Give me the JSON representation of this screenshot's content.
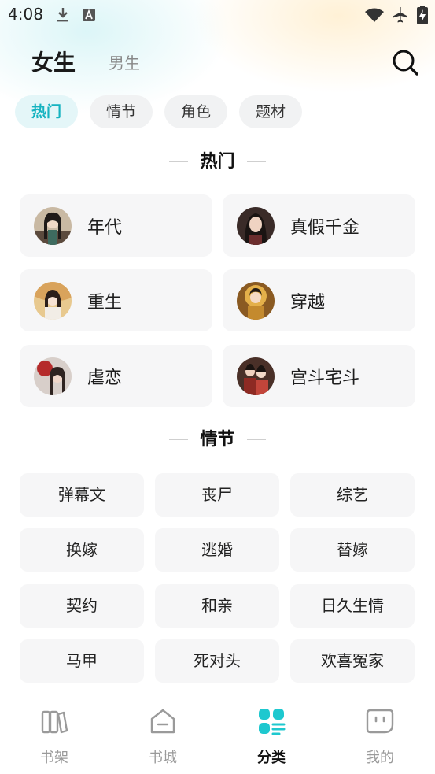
{
  "status_bar": {
    "time": "4:08",
    "left_icons": [
      "download-icon",
      "a-notification-icon"
    ],
    "right_icons": [
      "wifi-icon",
      "airplane-icon",
      "battery-charging-icon"
    ]
  },
  "header": {
    "tab_active": "女生",
    "tab_inactive": "男生",
    "search_icon": "search-icon"
  },
  "chips": [
    {
      "label": "热门",
      "active": true
    },
    {
      "label": "情节",
      "active": false
    },
    {
      "label": "角色",
      "active": false
    },
    {
      "label": "题材",
      "active": false
    }
  ],
  "hot_section": {
    "title": "热门",
    "items": [
      {
        "label": "年代"
      },
      {
        "label": "真假千金"
      },
      {
        "label": "重生"
      },
      {
        "label": "穿越"
      },
      {
        "label": "虐恋"
      },
      {
        "label": "宫斗宅斗"
      }
    ]
  },
  "plot_section": {
    "title": "情节",
    "items": [
      "弹幕文",
      "丧尸",
      "综艺",
      "换嫁",
      "逃婚",
      "替嫁",
      "契约",
      "和亲",
      "日久生情",
      "马甲",
      "死对头",
      "欢喜冤家"
    ]
  },
  "bottom_nav": {
    "items": [
      {
        "label": "书架",
        "icon": "bookshelf-icon",
        "active": false
      },
      {
        "label": "书城",
        "icon": "bookstore-icon",
        "active": false
      },
      {
        "label": "分类",
        "icon": "category-icon",
        "active": true
      },
      {
        "label": "我的",
        "icon": "profile-face-icon",
        "active": false
      }
    ]
  },
  "colors": {
    "accent": "#16b3c0",
    "card_bg": "#f6f6f7",
    "chip_bg": "#f1f2f3",
    "chip_active_bg": "#e4f6f8"
  }
}
